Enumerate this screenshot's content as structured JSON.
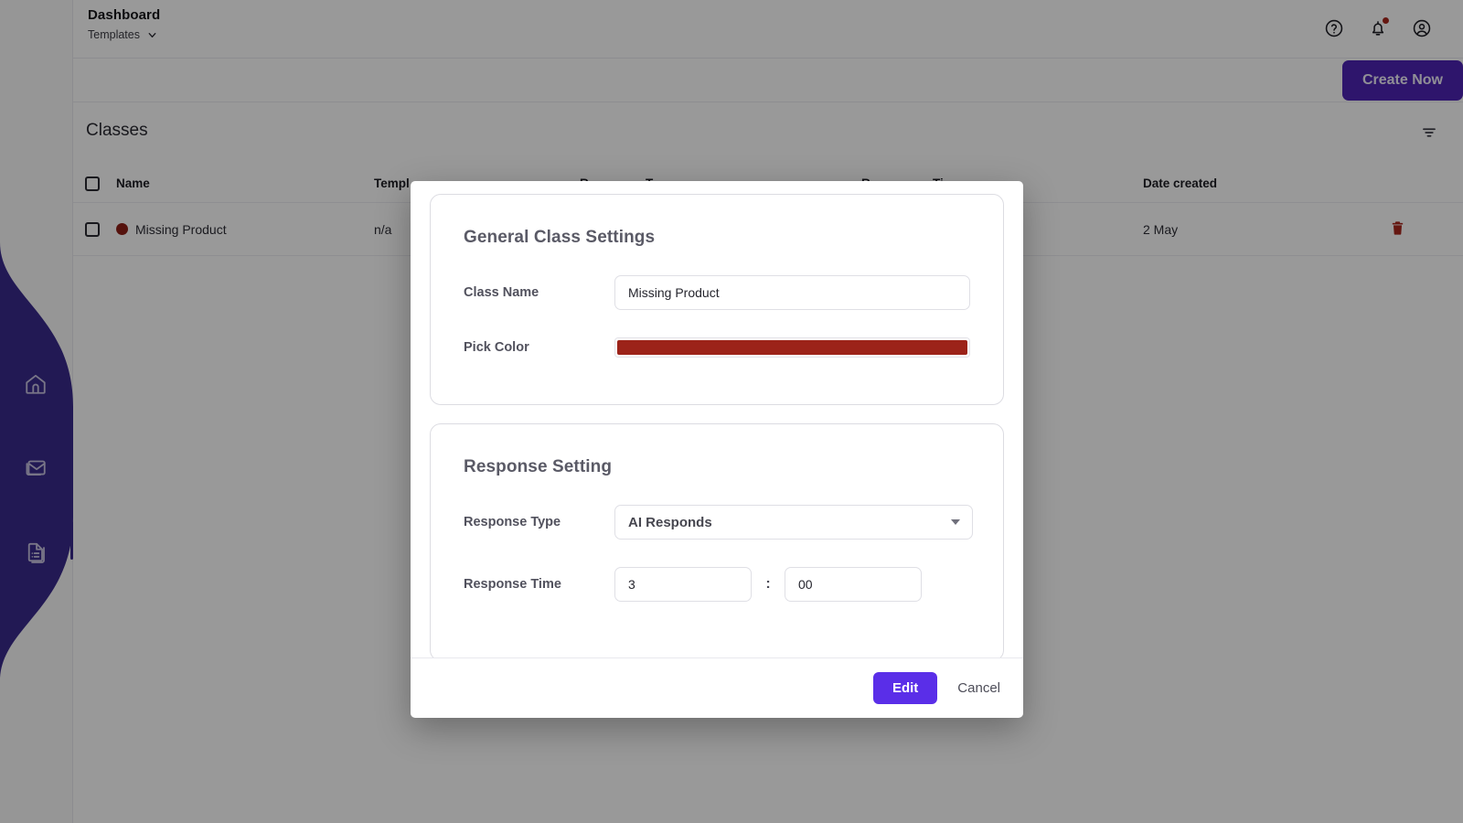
{
  "topbar": {
    "title": "Dashboard",
    "subtitle": "Templates",
    "chevron_icon": "chevron-down-icon",
    "help_icon": "help-circle-icon",
    "notifications_icon": "bell-icon",
    "account_icon": "user-circle-icon",
    "has_notification_badge": true,
    "badge_color": "#a8271d"
  },
  "sidebar": {
    "accent_color": "#3a2a8c",
    "items": [
      {
        "icon": "home-icon",
        "name": "home"
      },
      {
        "icon": "mail-icon",
        "name": "inbox"
      },
      {
        "icon": "document-list-icon",
        "name": "documents",
        "active": true
      }
    ]
  },
  "actions": {
    "create_now_label": "Create Now",
    "create_now_color": "#4d23b5",
    "filter_icon": "filter-icon"
  },
  "classes": {
    "section_title": "Classes",
    "columns": [
      "Name",
      "Templ",
      "R",
      "T",
      "R",
      "Ti",
      "Date created"
    ],
    "rows": [
      {
        "checked": false,
        "color": "#8e1f16",
        "name": "Missing Product",
        "template": "n/a",
        "date_created": "2 May",
        "delete_icon": "trash-icon",
        "delete_color": "#a8271d"
      }
    ]
  },
  "modal": {
    "general": {
      "title": "General Class Settings",
      "class_name_label": "Class Name",
      "class_name_value": "Missing Product",
      "class_name_placeholder": "Class Name",
      "pick_color_label": "Pick Color",
      "pick_color_value": "#9c2319"
    },
    "response": {
      "title": "Response Setting",
      "response_type_label": "Response Type",
      "response_type_value": "AI Responds",
      "response_time_label": "Response Time",
      "response_time_minutes": "3",
      "response_time_seconds": "00",
      "time_separator": ":"
    },
    "footer": {
      "primary_label": "Edit",
      "primary_color": "#5a2ee8",
      "secondary_label": "Cancel"
    }
  }
}
